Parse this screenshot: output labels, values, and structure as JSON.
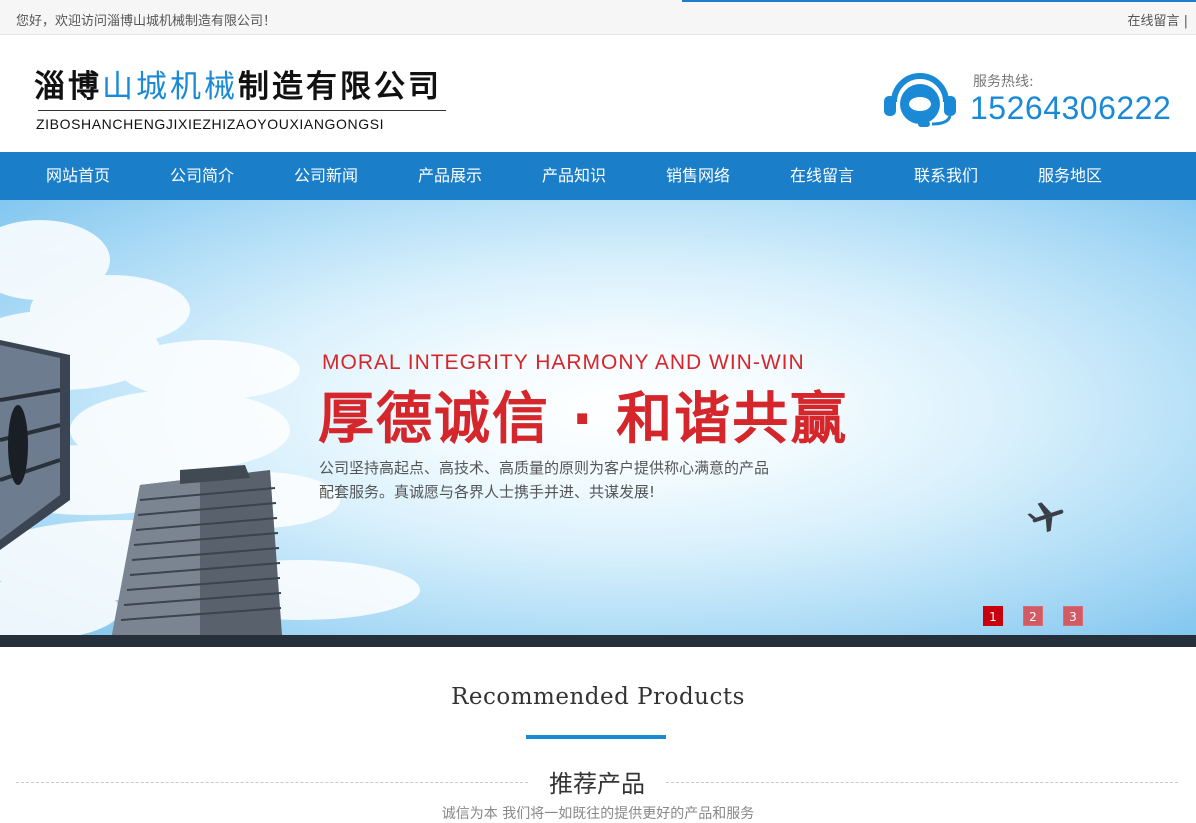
{
  "topbar": {
    "welcome": "您好，欢迎访问淄博山城机械制造有限公司！",
    "link": "在线留言 |"
  },
  "logo": {
    "cn_part1": "淄博",
    "cn_part2": "山城机械",
    "cn_part3": "制造有限公司",
    "en": "ZIBOSHANCHENGJIXIEZHIZAOYOUXIANGONGSI"
  },
  "hotline": {
    "label": "服务热线:",
    "phone": "15264306222",
    "icon": "headset-icon"
  },
  "nav": {
    "items": [
      {
        "label": "网站首页"
      },
      {
        "label": "公司简介"
      },
      {
        "label": "公司新闻"
      },
      {
        "label": "产品展示"
      },
      {
        "label": "产品知识"
      },
      {
        "label": "销售网络"
      },
      {
        "label": "在线留言"
      },
      {
        "label": "联系我们"
      },
      {
        "label": "服务地区"
      }
    ]
  },
  "banner": {
    "tagline_en": "MORAL INTEGRITY HARMONY AND WIN-WIN",
    "tagline_cn": "厚德诚信 · 和谐共赢",
    "desc_line1": "公司坚持高起点、高技术、高质量的原则为客户提供称心满意的产品",
    "desc_line2": "配套服务。真诚愿与各界人士携手并进、共谋发展!",
    "slides": [
      "1",
      "2",
      "3"
    ],
    "active_slide": 1
  },
  "recommended": {
    "title_en": "Recommended Products",
    "title_cn": "推荐产品",
    "subtitle": "诚信为本 我们将一如既往的提供更好的产品和服务"
  },
  "colors": {
    "brand_blue": "#1b7ec9",
    "accent_red": "#d4262b",
    "dark_strip": "#26303b"
  }
}
